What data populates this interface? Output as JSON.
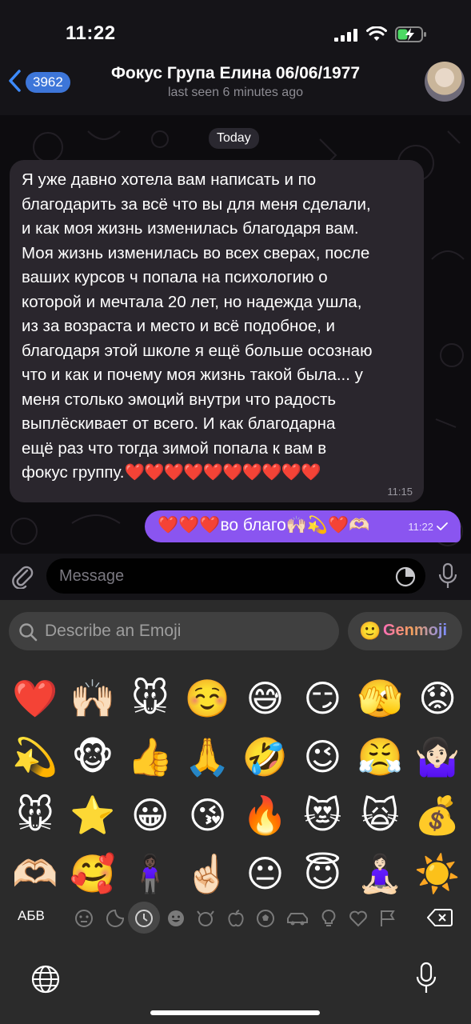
{
  "status": {
    "time": "11:22"
  },
  "header": {
    "back_badge": "3962",
    "title": "Фокус Група Елина 06/06/1977",
    "subtitle": "last seen 6 minutes ago"
  },
  "chat": {
    "date_label": "Today",
    "incoming": {
      "text": "Я уже давно хотела вам написать и по\nблагодарить за всё что вы для меня сделали,\nи как моя жизнь изменилась благодаря вам.\nМоя жизнь изменилась во всех сверах, после\nваших курсов ч попала на психологию о\nкоторой и мечтала 20 лет, но надежда ушла,\nиз за возраста и место и всё подобное, и\nблагодаря этой школе я ещё больше осознаю\nчто и как и почему моя жизнь такой была... у\nменя столько эмоций внутри что радость\nвыплёскивает от всего. И как благодарна\nещё раз что тогда зимой попала к вам в\nфокус группу.",
      "hearts": "❤️❤️❤️❤️❤️❤️❤️❤️❤️❤️",
      "time": "11:15"
    },
    "outgoing": {
      "text": "❤️❤️❤️во благо🙌🏻💫❤️🫶🏻",
      "time": "11:22"
    }
  },
  "input": {
    "placeholder": "Message"
  },
  "keyboard": {
    "search_placeholder": "Describe an Emoji",
    "genmoji_label": "Genmoji",
    "genmoji_icon": "🙂",
    "emoji_rows": [
      [
        "❤️",
        "🙌🏻",
        "🐭",
        "☺️",
        "😅",
        "😏",
        "🫣",
        "😟"
      ],
      [
        "💫",
        "🐵",
        "👍",
        "🙏",
        "🤣",
        "😉",
        "😤",
        "🤷🏻‍♀️"
      ],
      [
        "🐭",
        "⭐",
        "😀",
        "😘",
        "🔥",
        "😻",
        "🙀",
        "💰"
      ],
      [
        "🫶🏻",
        "🥰",
        "🧍🏿‍♀️",
        "☝🏻",
        "😐",
        "😇",
        "🧘🏻‍♀️",
        "☀️"
      ]
    ],
    "abc_label": "АБВ",
    "categories": [
      "memoji-icon",
      "sticker-icon",
      "recent-icon",
      "smiley-icon",
      "animal-icon",
      "food-icon",
      "activity-icon",
      "travel-icon",
      "objects-icon",
      "symbols-icon",
      "flags-icon"
    ]
  },
  "colors": {
    "accent": "#8a55f0",
    "badge": "#3d76d9",
    "incoming_bubble": "#2a262d",
    "heart": "#e0192c"
  }
}
